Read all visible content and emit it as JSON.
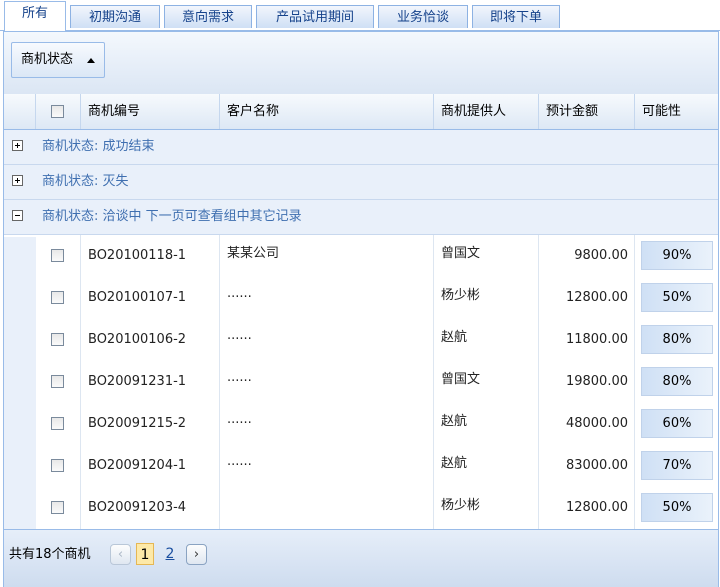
{
  "tabs": [
    "所有",
    "初期沟通",
    "意向需求",
    "产品试用期间",
    "业务恰谈",
    "即将下单"
  ],
  "toolbar": {
    "group_button": "商机状态"
  },
  "columns": [
    "商机编号",
    "客户名称",
    "商机提供人",
    "预计金额",
    "可能性"
  ],
  "groups": [
    {
      "label": "商机状态: 成功结束",
      "state": "collapsed"
    },
    {
      "label": "商机状态: 灭失",
      "state": "collapsed"
    },
    {
      "label": "商机状态: 洽谈中 下一页可查看组中其它记录",
      "state": "expanded"
    }
  ],
  "rows": [
    {
      "id": "BO20100118-1",
      "customer": "某某公司",
      "provider": "曾国文",
      "amount": "9800.00",
      "probability": "90%"
    },
    {
      "id": "BO20100107-1",
      "customer": "······",
      "provider": "杨少彬",
      "amount": "12800.00",
      "probability": "50%"
    },
    {
      "id": "BO20100106-2",
      "customer": "······",
      "provider": "赵航",
      "amount": "11800.00",
      "probability": "80%"
    },
    {
      "id": "BO20091231-1",
      "customer": "······",
      "provider": "曾国文",
      "amount": "19800.00",
      "probability": "80%"
    },
    {
      "id": "BO20091215-2",
      "customer": "······",
      "provider": "赵航",
      "amount": "48000.00",
      "probability": "60%"
    },
    {
      "id": "BO20091204-1",
      "customer": "······",
      "provider": "赵航",
      "amount": "83000.00",
      "probability": "70%"
    },
    {
      "id": "BO20091203-4",
      "customer": "",
      "provider": "杨少彬",
      "amount": "12800.00",
      "probability": "50%"
    }
  ],
  "footer": {
    "total": "共有18个商机",
    "prev": "‹",
    "next": "›",
    "pages": [
      "1",
      "2"
    ],
    "current_page": "1"
  },
  "icons": {
    "prev": "chevron-left-icon",
    "next": "chevron-right-icon",
    "collapsed": "plus-icon",
    "expanded": "minus-icon",
    "sort": "triangle-up-icon"
  },
  "colors": {
    "accent": "#15428b",
    "border": "#99bbe8",
    "group_text": "#3f6fb0",
    "current_page": "#fde9a8"
  }
}
